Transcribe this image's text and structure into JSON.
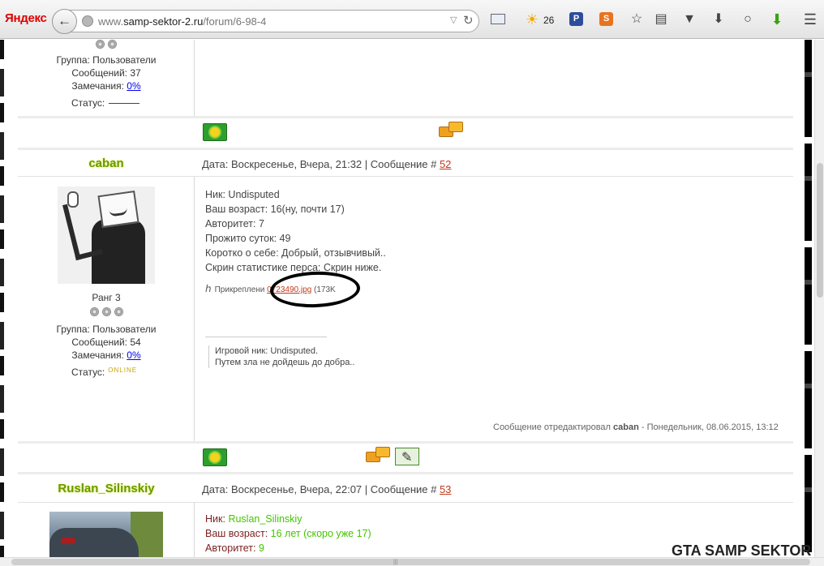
{
  "browser": {
    "brand": "Яндекс",
    "url_prefix": "www.",
    "url_domain": "samp-sektor-2.ru",
    "url_path": "/forum/6-98-4",
    "weather": "26",
    "icons": [
      "back-arrow-icon",
      "globe-icon",
      "mail-icon",
      "weather-sun-icon",
      "p-extension-icon",
      "s-extension-icon",
      "bookmark-star-icon",
      "reading-list-icon",
      "pocket-icon",
      "download-icon",
      "chat-icon",
      "green-download-icon",
      "menu-icon"
    ]
  },
  "post_prev": {
    "group": "Группа: Пользователи",
    "messages": "Сообщений: 37",
    "remarks_label": "Замечания: ",
    "remarks_value": "0%",
    "status_label": "Статус:"
  },
  "post_caban": {
    "nick": "caban",
    "meta_prefix": "Дата: Воскресенье, Вчера, 21:32 | Сообщение # ",
    "post_number": "52",
    "rank": "Ранг 3",
    "group": "Группа: Пользователи",
    "messages": "Сообщений: 54",
    "remarks_label": "Замечания: ",
    "remarks_value": "0%",
    "status_label": "Статус:",
    "status_value": "ONLINE",
    "body": [
      "Ник: Undisputed",
      "Ваш возраст: 16(ну, почти 17)",
      "Авторитет: 7",
      "Прожито суток: 49",
      "Коротко о себе: Добрый, отзывчивый..",
      "Скрин статистике перса: Скрин ниже."
    ],
    "attachment_label": "Прикреплени",
    "attachment_file": "0723490.jpg",
    "attachment_size": "(173K",
    "signature": [
      "Игровой ник: Undisputed.",
      "Путем зла не дойдешь до добра.."
    ],
    "edited_prefix": "Сообщение отредактировал ",
    "edited_user": "caban",
    "edited_suffix": " - Понедельник, 08.06.2015, 13:12"
  },
  "post_ruslan": {
    "nick": "Ruslan_Silinskiy",
    "meta_prefix": "Дата: Воскресенье, Вчера, 22:07 | Сообщение # ",
    "post_number": "53",
    "body": [
      {
        "key": "Ник: ",
        "value": "Ruslan_Silinskiy"
      },
      {
        "key": "Ваш возраст: ",
        "value": "16 лет (скоро уже 17)"
      },
      {
        "key": "Авторитет: ",
        "value": "9"
      }
    ]
  },
  "watermark": "GTA SAMP SEKTOR",
  "colors": {
    "nick": "#6a9a00",
    "link": "#c0391b",
    "value_green": "#44c400",
    "key_dark_red": "#7a1e1e"
  }
}
